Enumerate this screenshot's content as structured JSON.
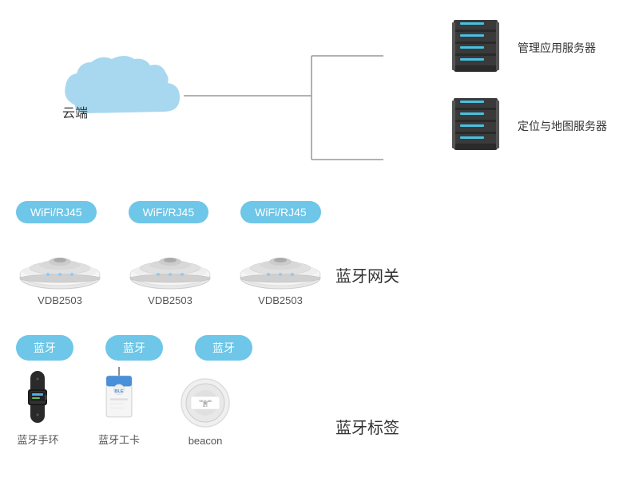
{
  "cloud": {
    "label": "云端"
  },
  "servers": [
    {
      "label": "管理应用服务器"
    },
    {
      "label": "定位与地图服务器"
    }
  ],
  "wifi_badges": [
    {
      "label": "WiFi/RJ45"
    },
    {
      "label": "WiFi/RJ45"
    },
    {
      "label": "WiFi/RJ45"
    }
  ],
  "gateways": [
    {
      "label": "VDB2503"
    },
    {
      "label": "VDB2503"
    },
    {
      "label": "VDB2503"
    }
  ],
  "gateway_section_title": "蓝牙网关",
  "bt_badges": [
    {
      "label": "蓝牙"
    },
    {
      "label": "蓝牙"
    },
    {
      "label": "蓝牙"
    }
  ],
  "tags": [
    {
      "label": "蓝牙手环"
    },
    {
      "label": "蓝牙工卡"
    },
    {
      "label": "beacon"
    }
  ],
  "tag_section_title": "蓝牙标签"
}
